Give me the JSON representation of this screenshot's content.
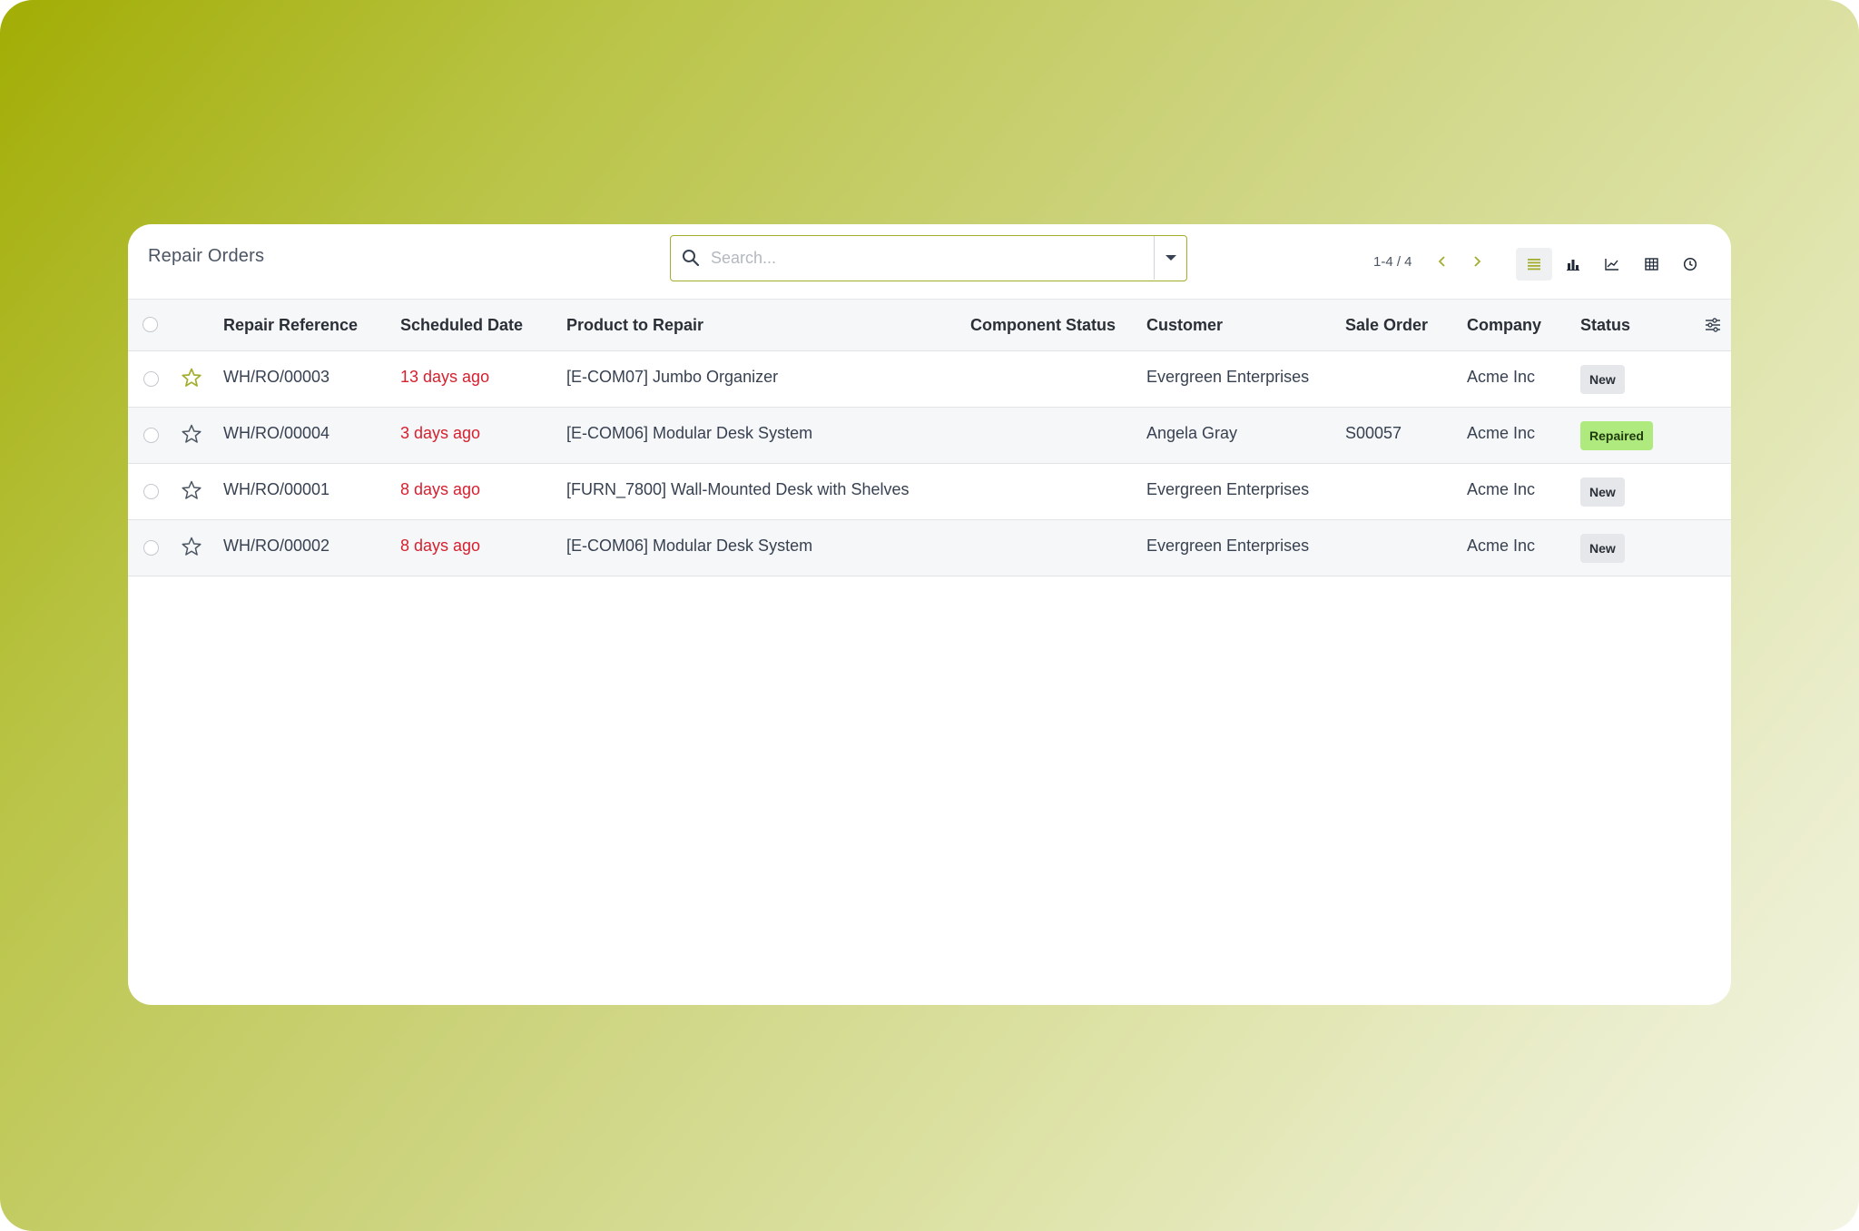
{
  "page_title": "Repair Orders",
  "search": {
    "placeholder": "Search..."
  },
  "pager": {
    "value": "1-4 / 4"
  },
  "colors": {
    "accent": "#a4ad2c",
    "overdue_date": "#d5202f",
    "badge_new": "#e5e7ea",
    "badge_repaired": "#aeea7e"
  },
  "icons": {
    "search": "search-icon",
    "dropdown": "caret-down-icon",
    "prev": "chevron-left-icon",
    "next": "chevron-right-icon",
    "views": [
      "list-view-icon",
      "bar-chart-icon",
      "line-chart-icon",
      "pivot-table-icon",
      "clock-icon"
    ],
    "column_settings": "sliders-icon"
  },
  "table": {
    "columns": {
      "reference": "Repair Reference",
      "scheduled_date": "Scheduled Date",
      "product": "Product to Repair",
      "component_status": "Component Status",
      "customer": "Customer",
      "sale_order": "Sale Order",
      "company": "Company",
      "status": "Status"
    },
    "rows": [
      {
        "reference": "WH/RO/00003",
        "scheduled_date": "13 days ago",
        "product": "[E-COM07] Jumbo Organizer",
        "component_status": "",
        "customer": "Evergreen Enterprises",
        "sale_order": "",
        "company": "Acme Inc",
        "status": "New",
        "starred": true
      },
      {
        "reference": "WH/RO/00004",
        "scheduled_date": "3 days ago",
        "product": "[E-COM06] Modular Desk System",
        "component_status": "",
        "customer": "Angela Gray",
        "sale_order": "S00057",
        "company": "Acme Inc",
        "status": "Repaired",
        "starred": false
      },
      {
        "reference": "WH/RO/00001",
        "scheduled_date": "8 days ago",
        "product": "[FURN_7800] Wall-Mounted Desk with Shelves",
        "component_status": "",
        "customer": "Evergreen Enterprises",
        "sale_order": "",
        "company": "Acme Inc",
        "status": "New",
        "starred": false
      },
      {
        "reference": "WH/RO/00002",
        "scheduled_date": "8 days ago",
        "product": "[E-COM06] Modular Desk System",
        "component_status": "",
        "customer": "Evergreen Enterprises",
        "sale_order": "",
        "company": "Acme Inc",
        "status": "New",
        "starred": false
      }
    ]
  }
}
